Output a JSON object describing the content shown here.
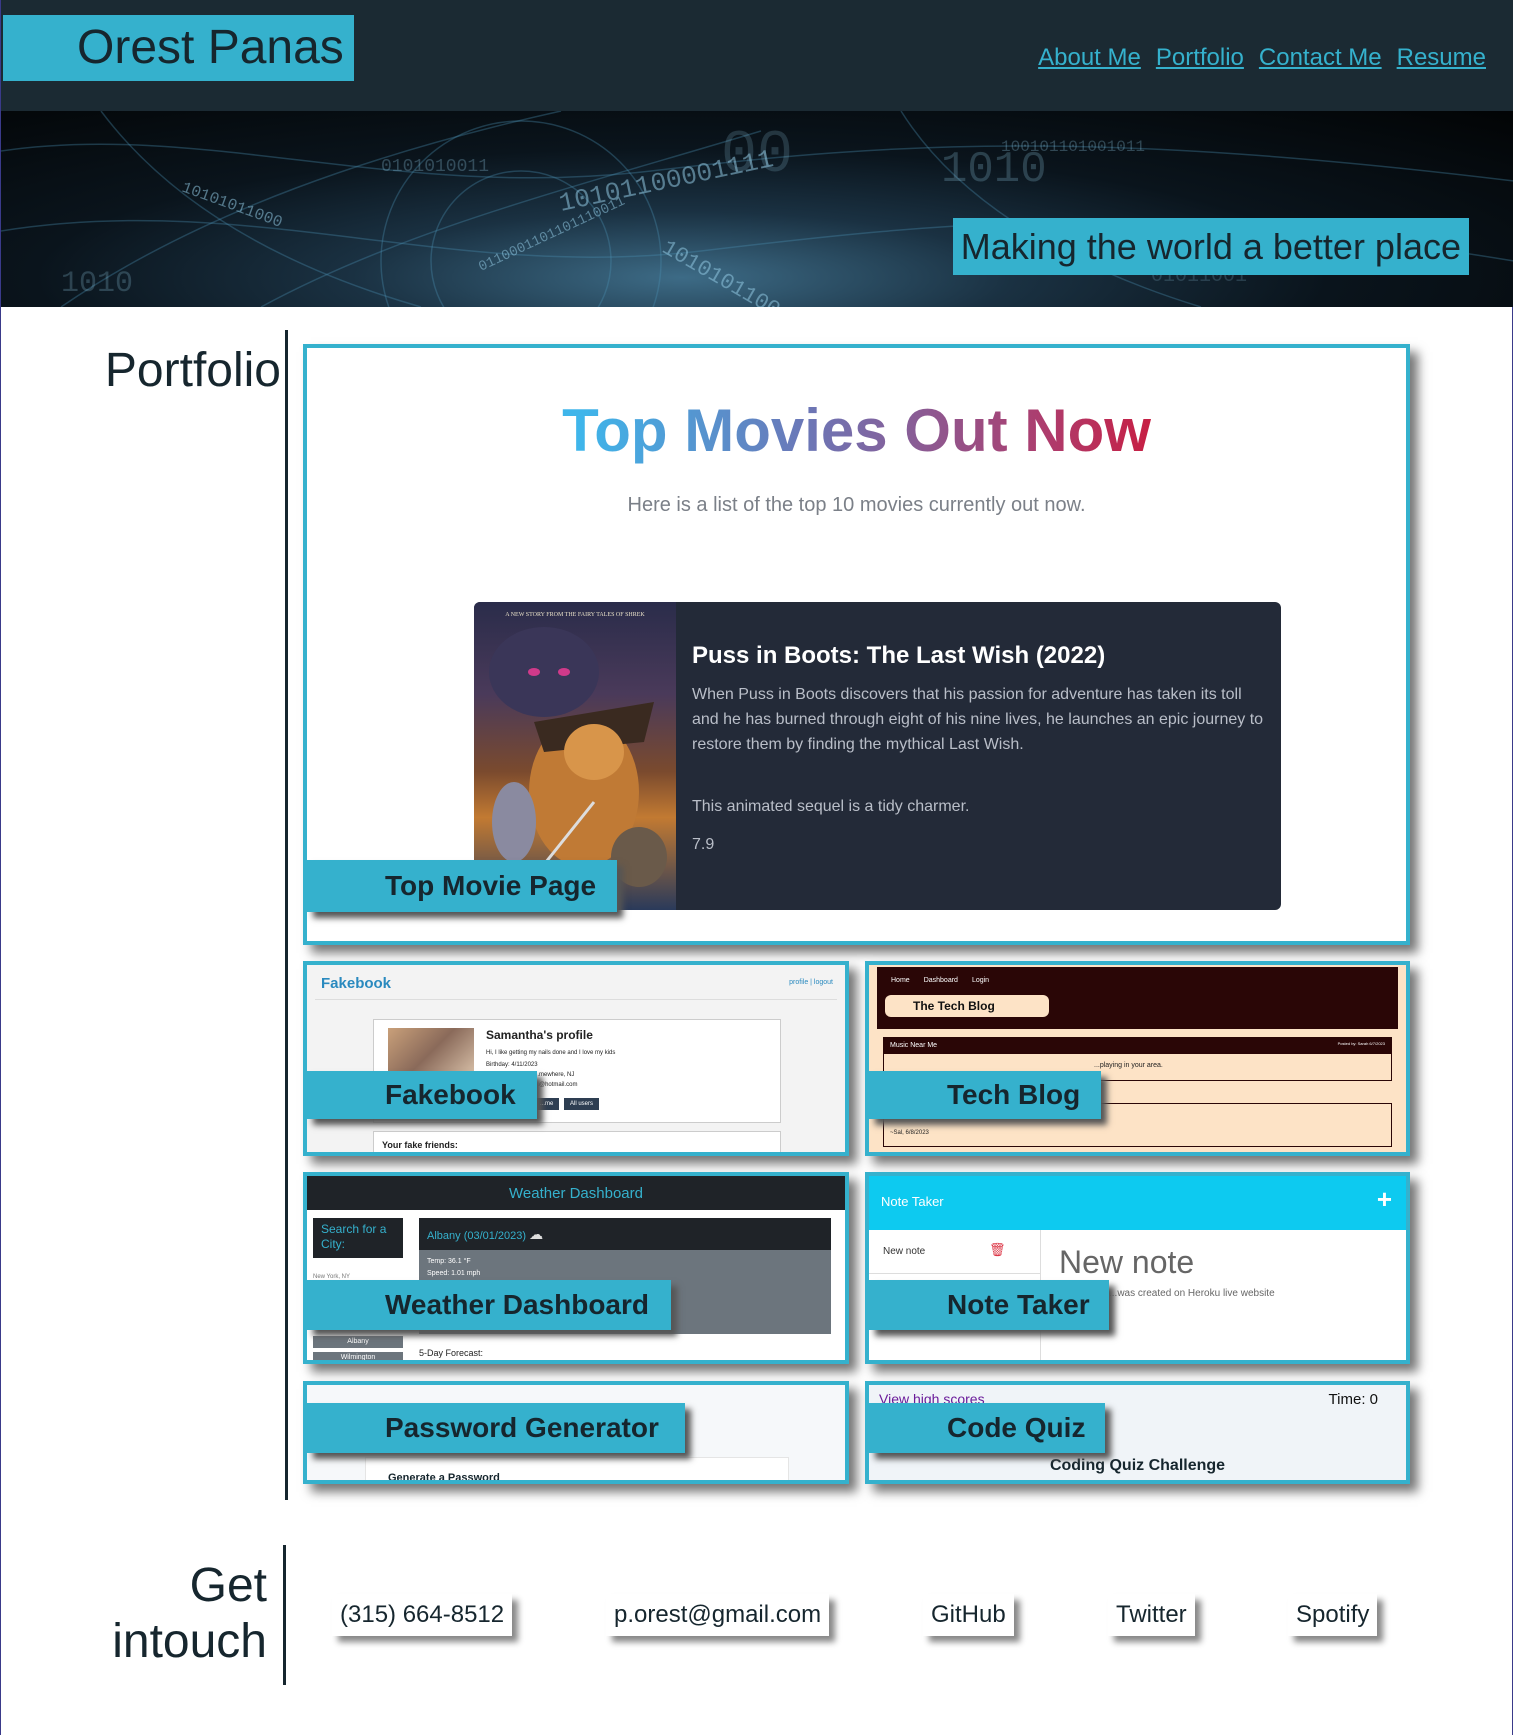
{
  "header": {
    "name": "Orest Panas",
    "nav": [
      "About Me",
      "Portfolio",
      "Contact Me",
      "Resume"
    ],
    "tagline": "Making the world a better place"
  },
  "portfolio": {
    "title": "Portfolio",
    "featured": {
      "label": "Top Movie Page",
      "heading": "Top Movies Out Now",
      "subheading": "Here is a list of the top 10 movies currently out now.",
      "movie_title": "Puss in Boots: The Last Wish (2022)",
      "movie_description": "When Puss in Boots discovers that his passion for adventure has taken its toll and he has burned through eight of his nine lives, he launches an epic journey to restore them by finding the mythical Last Wish.",
      "movie_tagline": "This animated sequel is a tidy charmer.",
      "movie_rating": "7.9",
      "poster_caption": "A NEW STORY FROM THE FAIRY TALES OF SHREK"
    },
    "projects": [
      {
        "label": "Fakebook",
        "preview": {
          "brand": "Fakebook",
          "top_links": "profile | logout",
          "profile_title": "Samantha's profile",
          "bio": "Hi, I like getting my nails done and I love my kids",
          "birthday": "Birthday: 4/11/2023",
          "location": "...mewhere, NJ",
          "email": "...@hotmail.com",
          "btn1": "...me",
          "btn2": "All users",
          "friends": "Your fake friends:"
        }
      },
      {
        "label": "Tech Blog",
        "preview": {
          "nav": [
            "Home",
            "Dashboard",
            "Login"
          ],
          "brand": "The Tech Blog",
          "post_title": "Music Near Me",
          "post_meta": "Posted by: Sarah 6/7/2023",
          "post_body": "...playing in your area.",
          "comment_meta": "~Sal, 6/8/2023"
        }
      },
      {
        "label": "Weather Dashboard",
        "preview": {
          "title": "Weather Dashboard",
          "search_label": "Search for a City:",
          "search_value": "New York, NY",
          "city": "Albany (03/01/2023)",
          "temp": "Temp: 36.1 °F",
          "wind": "Speed: 1.01 mph",
          "history": [
            "Albany",
            "Wilmington"
          ],
          "forecast": "5-Day Forecast:"
        }
      },
      {
        "label": "Note Taker",
        "preview": {
          "title": "Note Taker",
          "plus": "+",
          "list_item": "New note",
          "note_title": "New note",
          "note_body": "...was created on Heroku live website"
        }
      },
      {
        "label": "Password Generator",
        "preview": {
          "heading": "Generate a Password"
        }
      },
      {
        "label": "Code Quiz",
        "preview": {
          "high_scores": "View high scores",
          "timer": "Time: 0",
          "heading": "Coding Quiz Challenge"
        }
      }
    ]
  },
  "contact": {
    "title_line1": "Get",
    "title_line2": "intouch",
    "links": [
      "(315) 664-8512",
      "p.orest@gmail.com",
      "GitHub",
      "Twitter",
      "Spotify"
    ]
  },
  "colors": {
    "accent": "#35b1cd",
    "dark": "#16262e",
    "header_bg": "#1b2a33"
  }
}
